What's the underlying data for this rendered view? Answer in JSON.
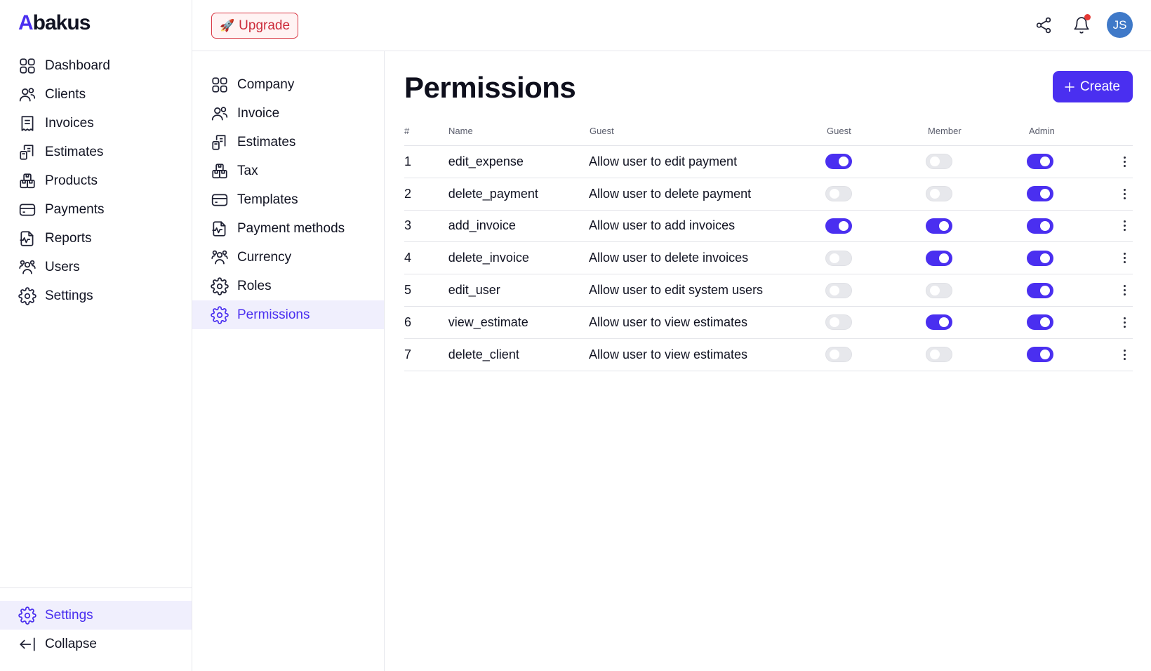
{
  "brand": {
    "first": "A",
    "rest": "bakus"
  },
  "sidebar": {
    "items": [
      {
        "label": "Dashboard",
        "icon": "grid-icon"
      },
      {
        "label": "Clients",
        "icon": "users-icon"
      },
      {
        "label": "Invoices",
        "icon": "receipt-icon"
      },
      {
        "label": "Estimates",
        "icon": "calculator-icon"
      },
      {
        "label": "Products",
        "icon": "boxes-icon"
      },
      {
        "label": "Payments",
        "icon": "credit-card-icon"
      },
      {
        "label": "Reports",
        "icon": "chart-file-icon"
      },
      {
        "label": "Users",
        "icon": "users-group-icon"
      },
      {
        "label": "Settings",
        "icon": "gear-icon"
      }
    ],
    "bottom": {
      "settings_label": "Settings",
      "collapse_label": "Collapse"
    }
  },
  "topbar": {
    "upgrade_label": "Upgrade",
    "upgrade_emoji": "🚀",
    "avatar_initials": "JS"
  },
  "settings_nav": {
    "items": [
      {
        "label": "Company",
        "icon": "grid-icon"
      },
      {
        "label": "Invoice",
        "icon": "users-icon"
      },
      {
        "label": "Estimates",
        "icon": "calculator-icon"
      },
      {
        "label": "Tax",
        "icon": "boxes-icon"
      },
      {
        "label": "Templates",
        "icon": "credit-card-icon"
      },
      {
        "label": "Payment methods",
        "icon": "chart-file-icon"
      },
      {
        "label": "Currency",
        "icon": "users-group-icon"
      },
      {
        "label": "Roles",
        "icon": "gear-icon"
      },
      {
        "label": "Permissions",
        "icon": "gear-icon",
        "active": true
      }
    ]
  },
  "page": {
    "title": "Permissions",
    "create_label": "Create"
  },
  "table": {
    "headers": {
      "num": "#",
      "name": "Name",
      "desc": "Guest",
      "guest": "Guest",
      "member": "Member",
      "admin": "Admin"
    },
    "rows": [
      {
        "num": "1",
        "name": "edit_expense",
        "desc": "Allow user to edit payment",
        "guest": true,
        "member": false,
        "admin": true
      },
      {
        "num": "2",
        "name": "delete_payment",
        "desc": "Allow user to delete payment",
        "guest": false,
        "member": false,
        "admin": true
      },
      {
        "num": "3",
        "name": "add_invoice",
        "desc": "Allow user to add invoices",
        "guest": true,
        "member": true,
        "admin": true
      },
      {
        "num": "4",
        "name": "delete_invoice",
        "desc": "Allow user to delete invoices",
        "guest": false,
        "member": true,
        "admin": true
      },
      {
        "num": "5",
        "name": "edit_user",
        "desc": "Allow user to edit system users",
        "guest": false,
        "member": false,
        "admin": true
      },
      {
        "num": "6",
        "name": "view_estimate",
        "desc": "Allow user to view estimates",
        "guest": false,
        "member": true,
        "admin": true
      },
      {
        "num": "7",
        "name": "delete_client",
        "desc": "Allow user to view estimates",
        "guest": false,
        "member": false,
        "admin": true
      }
    ]
  },
  "colors": {
    "accent": "#4a2ff0",
    "upgrade_red": "#cc2b3a",
    "avatar_blue": "#3f79c8",
    "notification_dot": "#e53935"
  }
}
